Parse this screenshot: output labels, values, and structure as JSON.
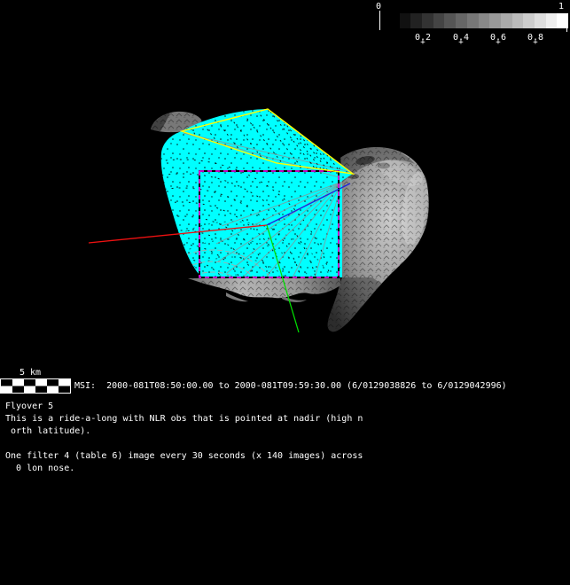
{
  "colorbar": {
    "min_label": "0",
    "max_label": "1",
    "tick_labels": [
      "0.2",
      "0.4",
      "0.6",
      "0.8"
    ],
    "tick_mark": "+",
    "steps": 16
  },
  "scalebar": {
    "label": "5 km"
  },
  "caption": {
    "msi_line": "MSI:  2000-081T08:50:00.00 to 2000-081T09:59:30.00 (6/0129038826 to 6/0129042996)"
  },
  "description": {
    "lines": [
      "Flyover 5",
      "This is a ride-a-long with NLR obs that is pointed at nadir (high n",
      " orth latitude).",
      "",
      "One filter 4 (table 6) image every 30 seconds (x 140 images) across",
      "  0 lon nose."
    ]
  },
  "scene": {
    "subject": "asteroid shape model with MSI image footprint coverage",
    "colors": {
      "coverage_fill": "#00ffff",
      "latest_image_outline": "#ffff00",
      "current_image_outline": "#ff00ff",
      "axis_x": "#ee1111",
      "axis_y": "#00dd00",
      "axis_z": "#2222dd",
      "background": "#000000",
      "text": "#ffffff"
    }
  }
}
